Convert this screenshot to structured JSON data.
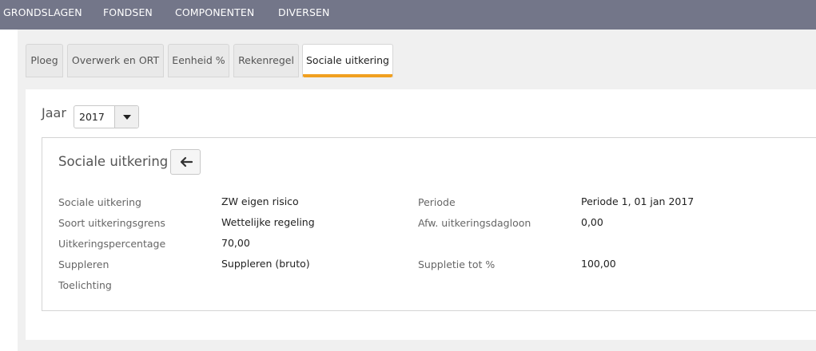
{
  "nav": {
    "items": [
      "GRONDSLAGEN",
      "FONDSEN",
      "COMPONENTEN",
      "DIVERSEN"
    ]
  },
  "tabs": [
    {
      "label": "Ploeg"
    },
    {
      "label": "Overwerk en ORT"
    },
    {
      "label": "Eenheid %"
    },
    {
      "label": "Rekenregel"
    },
    {
      "label": "Sociale uitkering",
      "active": true
    }
  ],
  "filter": {
    "jaar_label": "Jaar",
    "jaar_value": "2017"
  },
  "card": {
    "title": "Sociale uitkering",
    "back_icon": "arrow-left-icon",
    "left_fields": [
      {
        "label": "Sociale uitkering",
        "value": "ZW eigen risico"
      },
      {
        "label": "Soort uitkeringsgrens",
        "value": "Wettelijke regeling"
      },
      {
        "label": "Uitkeringspercentage",
        "value": "70,00"
      },
      {
        "label": "Suppleren",
        "value": "Suppleren (bruto)"
      },
      {
        "label": "Toelichting",
        "value": ""
      }
    ],
    "right_fields": [
      {
        "label": "Periode",
        "value": "Periode 1, 01 jan 2017"
      },
      {
        "label": "Afw. uitkeringsdagloon",
        "value": "0,00"
      },
      {
        "label": "Suppletie tot %",
        "value": "100,00"
      }
    ]
  },
  "colors": {
    "nav_bg": "#737689",
    "tab_accent": "#f0a020"
  }
}
